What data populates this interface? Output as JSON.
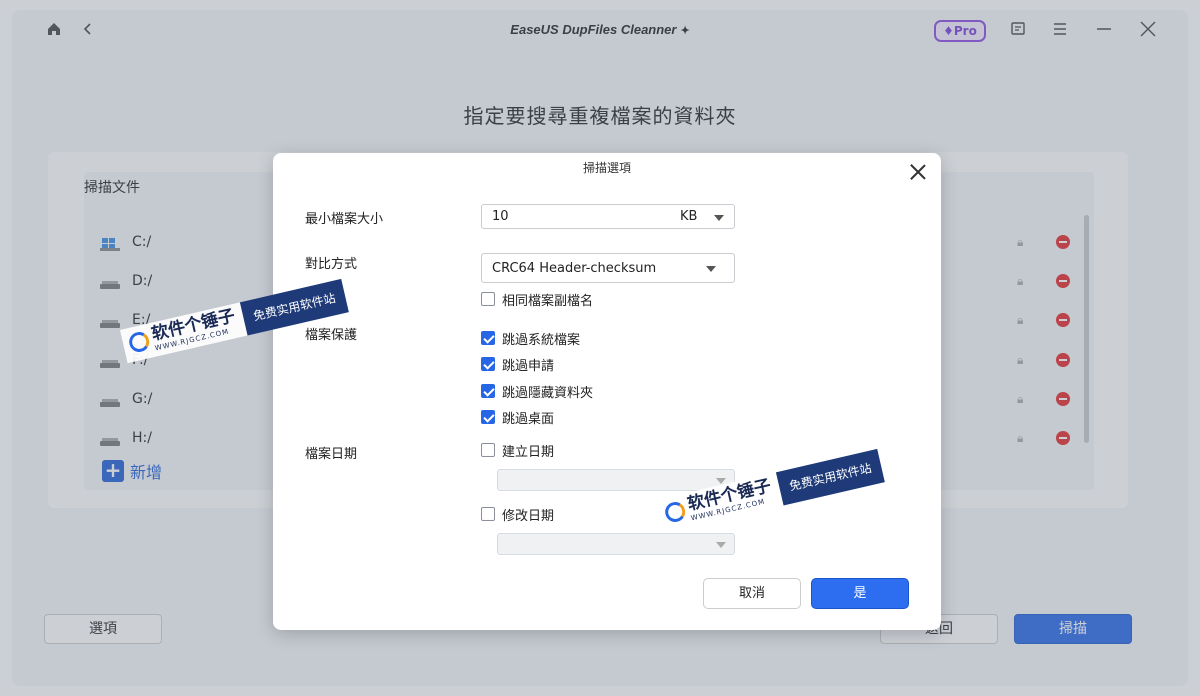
{
  "app": {
    "title": "EaseUS DupFiles Cleanner",
    "sparkle_icon": "sparkle-icon",
    "pro_label": "Pro"
  },
  "page": {
    "title": "指定要搜尋重複檔案的資料夾"
  },
  "scan_panel": {
    "label": "掃描文件",
    "drives": [
      {
        "name": "C:/",
        "icon": "windows-drive-icon"
      },
      {
        "name": "D:/",
        "icon": "drive-icon"
      },
      {
        "name": "E:/",
        "icon": "drive-icon"
      },
      {
        "name": "F:/",
        "icon": "drive-icon"
      },
      {
        "name": "G:/",
        "icon": "drive-icon"
      },
      {
        "name": "H:/",
        "icon": "drive-icon"
      }
    ],
    "add_label": "新增"
  },
  "footer": {
    "options_label": "選項",
    "back_label": "返回",
    "scan_label": "掃描"
  },
  "dialog": {
    "title": "掃描選項",
    "min_size_label": "最小檔案大小",
    "min_size_value": "10",
    "min_size_unit": "KB",
    "compare_label": "對比方式",
    "compare_value": "CRC64 Header-checksum",
    "same_ext_label": "相同檔案副檔名",
    "same_ext_checked": false,
    "protection_label": "檔案保護",
    "protection_options": [
      {
        "label": "跳過系統檔案",
        "checked": true
      },
      {
        "label": "跳過申請",
        "checked": true
      },
      {
        "label": "跳過隱藏資料夾",
        "checked": true
      },
      {
        "label": "跳過桌面",
        "checked": true
      }
    ],
    "date_label": "檔案日期",
    "created_label": "建立日期",
    "created_checked": false,
    "modified_label": "修改日期",
    "modified_checked": false,
    "cancel_label": "取消",
    "ok_label": "是"
  },
  "watermark": {
    "name": "软件个锤子",
    "url": "WWW.RJGCZ.COM",
    "slogan": "免费实用软件站"
  }
}
